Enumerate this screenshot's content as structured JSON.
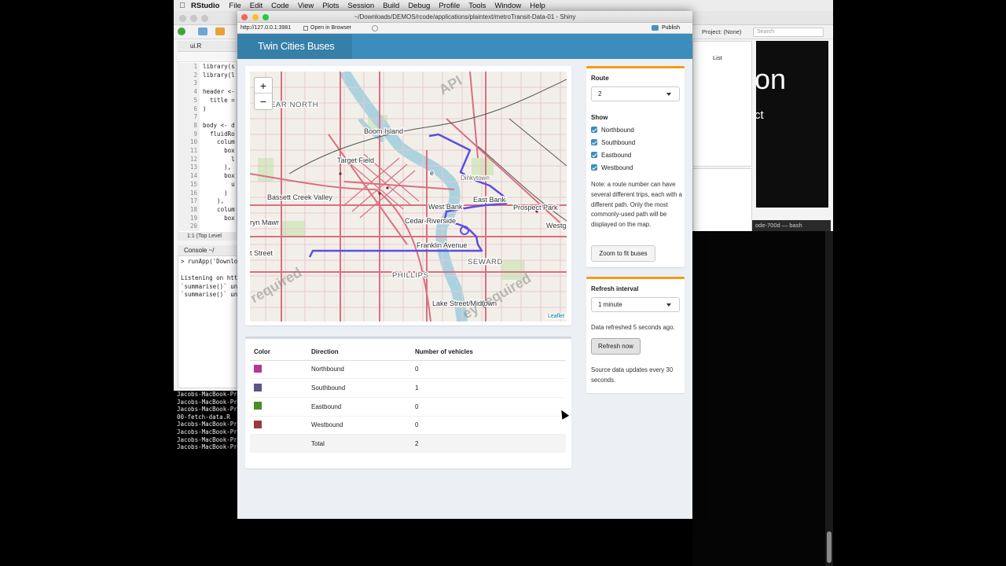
{
  "menubar": {
    "app": "RStudio",
    "items": [
      "File",
      "Edit",
      "Code",
      "View",
      "Plots",
      "Session",
      "Build",
      "Debug",
      "Profile",
      "Tools",
      "Window",
      "Help"
    ]
  },
  "rstudio": {
    "file_tab": "ui.R",
    "line_numbers": [
      "1",
      "2",
      "3",
      "4",
      "5",
      "6",
      "7",
      "8",
      "9",
      "10",
      "11",
      "12",
      "13",
      "14",
      "15",
      "16",
      "17",
      "18",
      "19",
      "20"
    ],
    "code": "library(s\nlibrary(l\n\nheader <-\n  title =\n)\n\nbody <- d\n  fluidRo\n    colum\n      box\n        l\n      ),\n      box\n        u\n      )\n    ),\n    colum\n      box\n",
    "status": "1:1     (Top Level",
    "console_tab": "Console ~/",
    "console_lines": "> runApp('Downlo\n\nListening on htt\n`summarise()` un\n`summarise()` un",
    "project": "Project: (None)",
    "search_placeholder": "Search",
    "list_label": "List",
    "viewer_big": "on",
    "viewer_small": "ct",
    "bash_bar": "ode-700d — bash"
  },
  "terminal": {
    "lines": [
      "Jacobs-MacBook-Pr",
      "Jacobs-MacBook-Pr",
      "Jacobs-MacBook-Pr",
      "00-fetch-data.R",
      "Jacobs-MacBook-Pr",
      "Jacobs-MacBook-Pr",
      "Jacobs-MacBook-Pr",
      "Jacobs-MacBook-Pr"
    ]
  },
  "shiny_window": {
    "title": "~/Downloads/DEMOS/rcode/applications/plaintext/metroTransit-Data-01 - Shiny",
    "url": "http://127.0.0.1:3981",
    "open_in_browser": "Open in Browser",
    "publish": "Publish"
  },
  "app": {
    "brand": "Twin Cities Buses",
    "map": {
      "zoom_in": "+",
      "zoom_out": "−",
      "attribution": "Leaflet",
      "labels": {
        "near_north": "EAR NORTH",
        "boom_island": "Boom Island",
        "target_field": "Target Field",
        "dinkytown": "Dinkytown",
        "bassett": "Bassett Creek Valley",
        "east_bank": "East Bank",
        "prospect_park": "Prospect Park",
        "west_bank": "West Bank",
        "bryn_mawr": "ryn Mawr",
        "cedar_riverside": "Cedar-Riverside",
        "westg": "Westg",
        "st_street": "t Street",
        "franklin": "Franklin Avenue",
        "seward": "SEWARD",
        "phillips": "PHILLIPS",
        "lake_street": "Lake Street/Midtown",
        "e_label": "e",
        "watermark_top": "API",
        "watermark_left": "required",
        "watermark_right": "ey required"
      }
    },
    "table": {
      "headers": [
        "Color",
        "Direction",
        "Number of vehicles"
      ],
      "rows": [
        {
          "color": "#b5379b",
          "direction": "Northbound",
          "count": "0"
        },
        {
          "color": "#5e528a",
          "direction": "Southbound",
          "count": "1"
        },
        {
          "color": "#4d8a2a",
          "direction": "Eastbound",
          "count": "0"
        },
        {
          "color": "#9c3a3a",
          "direction": "Westbound",
          "count": "0"
        }
      ],
      "total_label": "Total",
      "total_count": "2"
    },
    "controls": {
      "route_label": "Route",
      "route_value": "2",
      "show_label": "Show",
      "show_options": [
        "Northbound",
        "Southbound",
        "Eastbound",
        "Westbound"
      ],
      "note": "Note: a route number can have several different trips, each with a different path. Only the most commonly-used path will be displayed on the map.",
      "zoom_button": "Zoom to fit buses",
      "refresh_label": "Refresh interval",
      "refresh_value": "1 minute",
      "refreshed_text": "Data refreshed 5 seconds ago.",
      "refresh_button": "Refresh now",
      "source_note": "Source data updates every 30 seconds."
    }
  },
  "colors": {
    "header": "#3c8dbc",
    "brand": "#367fa9",
    "box_accent": "#f39c12",
    "route_line": "#5b4fe0"
  }
}
